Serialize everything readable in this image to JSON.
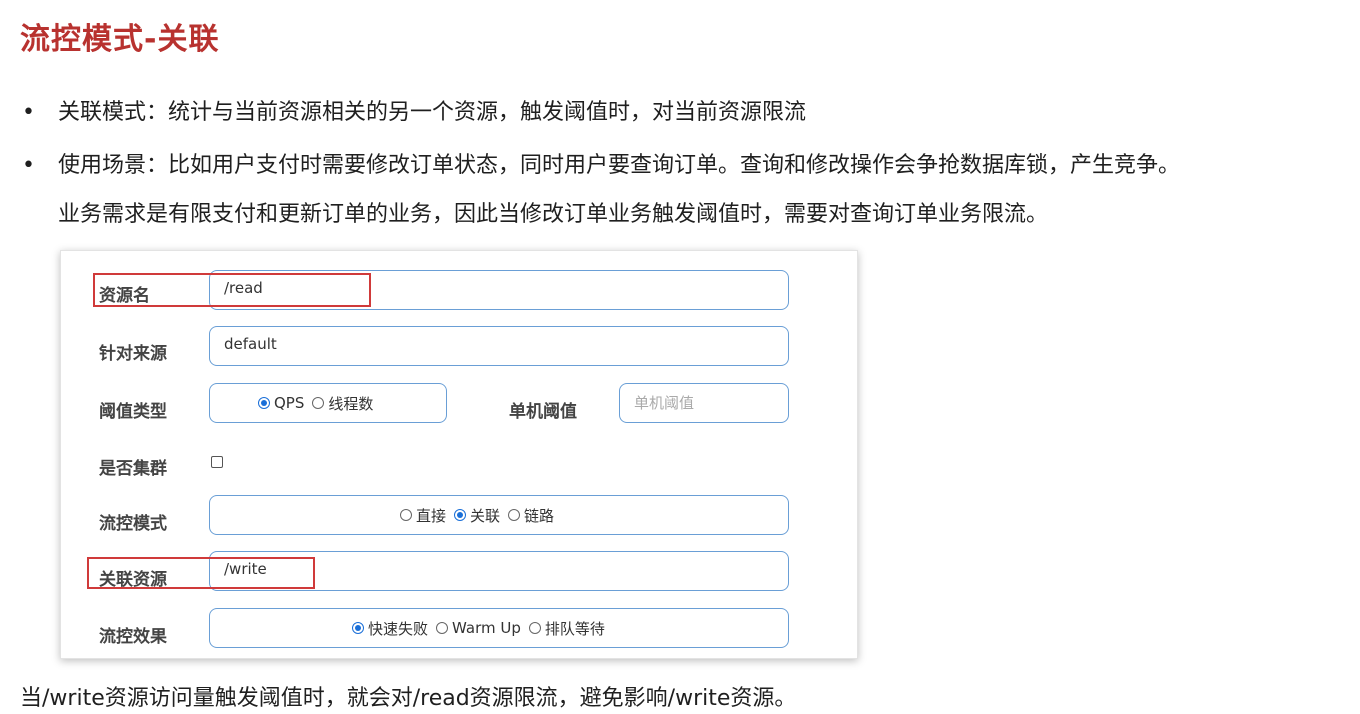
{
  "title": "流控模式-关联",
  "bullets": [
    {
      "dot": "•",
      "text": "关联模式：统计与当前资源相关的另一个资源，触发阈值时，对当前资源限流"
    },
    {
      "dot": "•",
      "text": "使用场景：比如用户支付时需要修改订单状态，同时用户要查询订单。查询和修改操作会争抢数据库锁，产生竞争。"
    }
  ],
  "bullet2_cont": "业务需求是有限支付和更新订单的业务，因此当修改订单业务触发阈值时，需要对查询订单业务限流。",
  "form": {
    "resource_label": "资源名",
    "resource_value": "/read",
    "origin_label": "针对来源",
    "origin_value": "default",
    "threshold_type_label": "阈值类型",
    "threshold_type_options": [
      "QPS",
      "线程数"
    ],
    "single_threshold_label": "单机阈值",
    "single_threshold_placeholder": "单机阈值",
    "cluster_label": "是否集群",
    "mode_label": "流控模式",
    "mode_options": [
      "直接",
      "关联",
      "链路"
    ],
    "related_label": "关联资源",
    "related_value": "/write",
    "effect_label": "流控效果",
    "effect_options": [
      "快速失败",
      "Warm Up",
      "排队等待"
    ]
  },
  "footer": "当/write资源访问量触发阈值时，就会对/read资源限流，避免影响/write资源。",
  "colors": {
    "title": "#b8322f",
    "field_border": "#6a9fd6",
    "highlight": "#d03a3a",
    "radio_on": "#1a6fd8"
  }
}
